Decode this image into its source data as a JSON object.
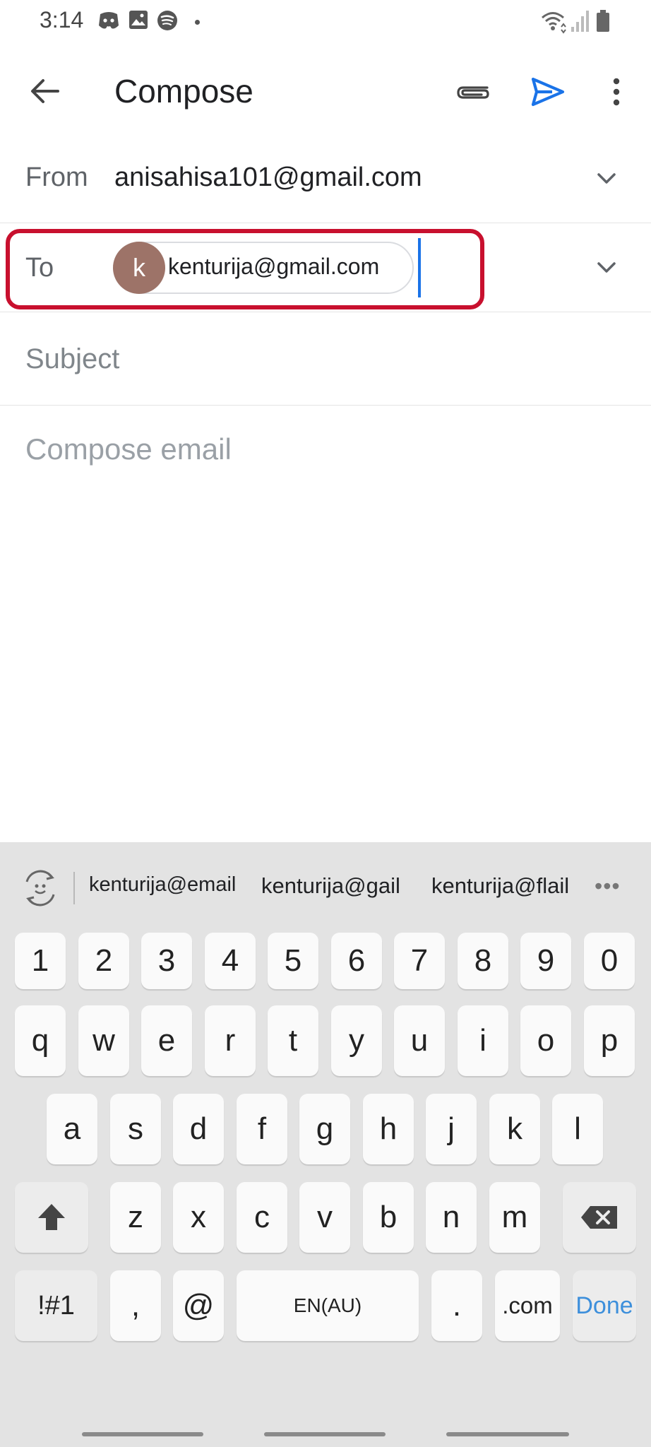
{
  "status_bar": {
    "time": "3:14",
    "icons_left": [
      "discord-icon",
      "gallery-icon",
      "spotify-icon",
      "notification-dot"
    ],
    "icons_right": [
      "wifi-icon",
      "signal-icon",
      "battery-icon"
    ]
  },
  "app_bar": {
    "title": "Compose",
    "actions": [
      "attach-icon",
      "send-icon",
      "more-icon"
    ],
    "send_color": "#1a73e8"
  },
  "form": {
    "from_label": "From",
    "from_value": "anisahisa101@gmail.com",
    "to_label": "To",
    "to_chip": {
      "avatar_letter": "k",
      "email": "kenturija@gmail.com",
      "avatar_color": "#9d7368"
    },
    "subject_placeholder": "Subject",
    "body_placeholder": "Compose email",
    "highlight_color": "#c8102e"
  },
  "keyboard": {
    "suggestions": [
      "kenturija@email",
      "kenturija@gail",
      "kenturija@flail"
    ],
    "more_label": "•••",
    "row_numbers": [
      "1",
      "2",
      "3",
      "4",
      "5",
      "6",
      "7",
      "8",
      "9",
      "0"
    ],
    "row_1": [
      "q",
      "w",
      "e",
      "r",
      "t",
      "y",
      "u",
      "i",
      "o",
      "p"
    ],
    "row_2": [
      "a",
      "s",
      "d",
      "f",
      "g",
      "h",
      "j",
      "k",
      "l"
    ],
    "row_3": [
      "z",
      "x",
      "c",
      "v",
      "b",
      "n",
      "m"
    ],
    "bottom": {
      "symbols": "!#1",
      "comma": ",",
      "at": "@",
      "space": "EN(AU)",
      "period": ".",
      "dotcom": ".com",
      "done": "Done"
    },
    "done_color": "#3d8fdb"
  }
}
